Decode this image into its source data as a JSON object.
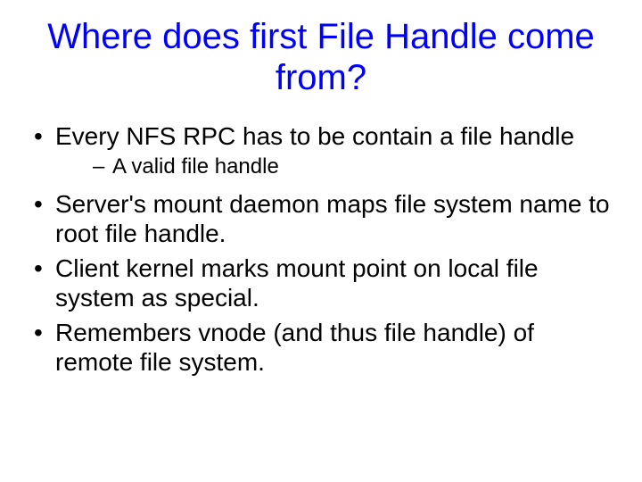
{
  "title": "Where does first File Handle come from?",
  "bullets": [
    {
      "text": "Every NFS RPC has to be contain a file handle",
      "sub": [
        "A valid file handle"
      ]
    },
    {
      "text": "Server's mount daemon maps file system name to root file handle."
    },
    {
      "text": "Client kernel marks mount point on local file system as special."
    },
    {
      "text": "Remembers vnode (and thus file handle) of remote file system."
    }
  ]
}
